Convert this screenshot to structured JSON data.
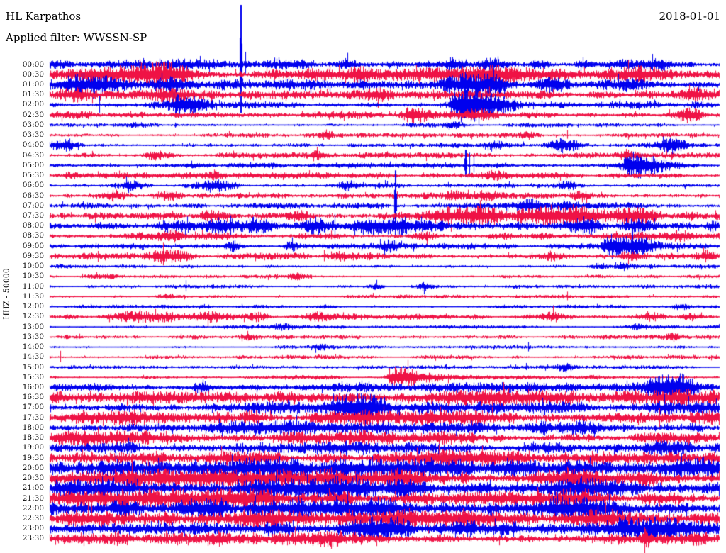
{
  "header": {
    "station": "HL Karpathos",
    "filter_line": "Applied filter: WWSSN-SP",
    "date": "2018-01-01"
  },
  "axis": {
    "left_label": "HHZ - 50000",
    "row_interval": "30 min",
    "time_format": "HH:MM"
  },
  "chart_data": {
    "type": "line",
    "subtype": "helicorder-seismogram",
    "title": "HL Karpathos",
    "filter": "WWSSN-SP",
    "date": "2018-01-01",
    "channel": "HHZ",
    "scale": 50000,
    "rows_per_day": 48,
    "minutes_per_row": 30,
    "legend_position": "none",
    "grid": false,
    "colors": {
      "blue": "#0000EE",
      "red": "#EF1245"
    },
    "rows": [
      {
        "t": "00:00",
        "c": "blue",
        "a": 5.5,
        "b": [
          [
            180,
            3,
            30
          ],
          [
            420,
            4,
            15
          ],
          [
            490,
            4,
            12
          ],
          [
            641,
            5,
            12
          ],
          [
            694,
            6,
            15
          ],
          [
            760,
            4,
            10
          ],
          [
            930,
            5,
            15
          ]
        ],
        "s": [
          [
            339,
            84,
            68
          ],
          [
            346,
            18,
            14
          ]
        ]
      },
      {
        "t": "00:30",
        "c": "red",
        "a": 6.5,
        "b": [
          [
            125,
            5,
            30
          ],
          [
            215,
            7,
            35
          ],
          [
            255,
            6,
            18
          ],
          [
            510,
            6,
            10
          ],
          [
            655,
            7,
            25
          ],
          [
            700,
            6,
            18
          ],
          [
            900,
            4,
            15
          ]
        ],
        "s": [
          [
            508,
            12,
            8
          ]
        ]
      },
      {
        "t": "01:00",
        "c": "blue",
        "a": 6,
        "b": [
          [
            125,
            7,
            28
          ],
          [
            240,
            7,
            22
          ],
          [
            657,
            8,
            18
          ],
          [
            692,
            9,
            14
          ],
          [
            780,
            5,
            10
          ],
          [
            885,
            5,
            14
          ]
        ],
        "s": [
          [
            240,
            12,
            8
          ]
        ]
      },
      {
        "t": "01:30",
        "c": "red",
        "a": 4.5,
        "b": [
          [
            110,
            5,
            22
          ],
          [
            240,
            5,
            18
          ],
          [
            530,
            4,
            12
          ],
          [
            980,
            4,
            14
          ]
        ],
        "s": [
          [
            85,
            9,
            7
          ]
        ]
      },
      {
        "t": "02:00",
        "c": "blue",
        "a": 4,
        "b": [
          [
            258,
            11,
            12,
            25
          ],
          [
            650,
            21,
            10,
            45
          ]
        ],
        "s": [
          [
            140,
            13,
            11
          ],
          [
            655,
            24,
            18
          ]
        ]
      },
      {
        "t": "02:30",
        "c": "red",
        "a": 4,
        "b": [
          [
            580,
            9,
            8,
            20
          ],
          [
            662,
            5,
            20
          ],
          [
            970,
            7,
            8,
            12
          ]
        ],
        "s": []
      },
      {
        "t": "03:00",
        "c": "blue",
        "a": 2.4,
        "b": [
          [
            190,
            2.5,
            15
          ],
          [
            640,
            2.5,
            10
          ]
        ],
        "s": []
      },
      {
        "t": "03:30",
        "c": "red",
        "a": 2.4,
        "b": [
          [
            460,
            4,
            6
          ],
          [
            745,
            3,
            8
          ]
        ],
        "s": [
          [
            800,
            7,
            5
          ]
        ]
      },
      {
        "t": "04:00",
        "c": "blue",
        "a": 3,
        "b": [
          [
            90,
            7,
            14
          ],
          [
            700,
            5,
            10
          ],
          [
            795,
            8,
            16
          ],
          [
            948,
            8,
            12
          ]
        ],
        "s": []
      },
      {
        "t": "04:30",
        "c": "red",
        "a": 3,
        "b": [
          [
            220,
            3.5,
            10
          ],
          [
            450,
            3.5,
            8
          ],
          [
            884,
            4,
            10
          ]
        ],
        "s": []
      },
      {
        "t": "05:00",
        "c": "blue",
        "a": 2.8,
        "b": [
          [
            890,
            13,
            8,
            40
          ]
        ],
        "s": [
          [
            656,
            22,
            16
          ],
          [
            662,
            18,
            12
          ],
          [
            668,
            14,
            10
          ],
          [
            893,
            18,
            12
          ]
        ]
      },
      {
        "t": "05:30",
        "c": "red",
        "a": 3.2,
        "b": [
          [
            100,
            3.5,
            10
          ],
          [
            300,
            3.5,
            10
          ],
          [
            700,
            4,
            12
          ]
        ],
        "s": []
      },
      {
        "t": "06:00",
        "c": "blue",
        "a": 3,
        "b": [
          [
            185,
            6,
            12
          ],
          [
            300,
            7,
            18
          ],
          [
            490,
            4,
            10
          ],
          [
            800,
            5,
            12
          ]
        ],
        "s": []
      },
      {
        "t": "06:30",
        "c": "red",
        "a": 3.4,
        "b": [
          [
            160,
            4,
            10
          ],
          [
            240,
            4,
            12
          ],
          [
            640,
            4,
            10
          ],
          [
            685,
            4,
            10
          ],
          [
            820,
            3.5,
            10
          ]
        ],
        "s": []
      },
      {
        "t": "07:00",
        "c": "blue",
        "a": 3.4,
        "b": [
          [
            745,
            5,
            14
          ],
          [
            800,
            4,
            10
          ]
        ],
        "s": [
          [
            557,
            50,
            22
          ],
          [
            795,
            9,
            20
          ]
        ]
      },
      {
        "t": "07:30",
        "c": "red",
        "a": 5.5,
        "b": [
          [
            300,
            5,
            15
          ],
          [
            420,
            5,
            12
          ],
          [
            630,
            7,
            15
          ],
          [
            680,
            7,
            18
          ],
          [
            765,
            8,
            25
          ],
          [
            825,
            8,
            28
          ],
          [
            900,
            6,
            18
          ]
        ],
        "s": []
      },
      {
        "t": "08:00",
        "c": "blue",
        "a": 6,
        "b": [
          [
            310,
            7,
            22
          ],
          [
            365,
            7,
            18
          ],
          [
            445,
            8,
            14
          ],
          [
            520,
            8,
            18
          ],
          [
            565,
            7,
            14
          ],
          [
            820,
            6,
            14
          ],
          [
            900,
            6,
            18
          ]
        ],
        "s": [
          [
            325,
            15,
            13
          ],
          [
            472,
            17,
            15
          ],
          [
            891,
            9,
            9
          ]
        ]
      },
      {
        "t": "08:30",
        "c": "red",
        "a": 4.2,
        "b": [
          [
            240,
            4,
            12
          ],
          [
            600,
            4,
            10
          ],
          [
            960,
            4,
            10
          ]
        ],
        "s": []
      },
      {
        "t": "09:00",
        "c": "blue",
        "a": 3,
        "b": [
          [
            330,
            5,
            8
          ],
          [
            410,
            5,
            7
          ],
          [
            550,
            5,
            8
          ],
          [
            860,
            12,
            6,
            25
          ],
          [
            900,
            8,
            10,
            20
          ]
        ],
        "s": [
          [
            891,
            21,
            17
          ]
        ]
      },
      {
        "t": "09:30",
        "c": "red",
        "a": 3.8,
        "b": [
          [
            225,
            6,
            18
          ],
          [
            255,
            5,
            14
          ],
          [
            480,
            5,
            10
          ],
          [
            780,
            5,
            12
          ],
          [
            890,
            5,
            10
          ],
          [
            1000,
            5,
            8
          ]
        ],
        "s": [
          [
            457,
            9,
            7
          ]
        ]
      },
      {
        "t": "10:00",
        "c": "blue",
        "a": 2,
        "b": [
          [
            845,
            3.5,
            8
          ],
          [
            880,
            3,
            8
          ]
        ],
        "s": []
      },
      {
        "t": "10:30",
        "c": "red",
        "a": 2,
        "b": [
          [
            150,
            2.5,
            14
          ],
          [
            420,
            2.5,
            10
          ]
        ],
        "s": []
      },
      {
        "t": "11:00",
        "c": "blue",
        "a": 2,
        "b": [
          [
            530,
            3.5,
            8
          ],
          [
            600,
            3.5,
            7
          ]
        ],
        "s": [
          [
            262,
            9,
            7
          ]
        ]
      },
      {
        "t": "11:30",
        "c": "red",
        "a": 2,
        "b": [
          [
            240,
            2.5,
            10
          ]
        ],
        "s": [
          [
            800,
            7,
            5
          ]
        ]
      },
      {
        "t": "12:00",
        "c": "blue",
        "a": 2,
        "b": [
          [
            460,
            2.5,
            10
          ],
          [
            960,
            2.5,
            8
          ]
        ],
        "s": []
      },
      {
        "t": "12:30",
        "c": "red",
        "a": 3.2,
        "b": [
          [
            180,
            5,
            22
          ],
          [
            235,
            5,
            18
          ],
          [
            295,
            4,
            14
          ],
          [
            365,
            5,
            10
          ],
          [
            445,
            4,
            10
          ],
          [
            780,
            5,
            14
          ],
          [
            920,
            4,
            10
          ],
          [
            975,
            4,
            9
          ]
        ],
        "s": []
      },
      {
        "t": "13:00",
        "c": "blue",
        "a": 1.9,
        "b": [
          [
            400,
            2.5,
            9
          ],
          [
            900,
            2.5,
            8
          ]
        ],
        "s": []
      },
      {
        "t": "13:30",
        "c": "red",
        "a": 2.3,
        "b": [
          [
            350,
            4,
            10
          ],
          [
            950,
            3,
            8
          ]
        ],
        "s": []
      },
      {
        "t": "14:00",
        "c": "blue",
        "a": 1.9,
        "b": [
          [
            450,
            2.5,
            10
          ]
        ],
        "s": [
          [
            745,
            7,
            6
          ]
        ]
      },
      {
        "t": "14:30",
        "c": "red",
        "a": 2.3,
        "b": [],
        "s": [
          [
            85,
            9,
            7
          ]
        ]
      },
      {
        "t": "15:00",
        "c": "blue",
        "a": 1.9,
        "b": [
          [
            797,
            5,
            8
          ]
        ],
        "s": [
          [
            742,
            6,
            4
          ]
        ]
      },
      {
        "t": "15:30",
        "c": "red",
        "a": 2.3,
        "b": [
          [
            555,
            11,
            5,
            45
          ]
        ],
        "s": [
          [
            549,
            13,
            8
          ]
        ]
      },
      {
        "t": "16:00",
        "c": "blue",
        "a": 3.6,
        "b": [
          [
            285,
            7,
            8
          ],
          [
            600,
            2,
            150
          ],
          [
            860,
            2,
            100
          ],
          [
            930,
            12,
            15,
            25
          ],
          [
            960,
            10,
            12
          ]
        ],
        "s": [
          [
            286,
            11,
            18
          ],
          [
            940,
            15,
            11
          ]
        ]
      },
      {
        "t": "16:30",
        "c": "red",
        "a": 6.5,
        "b": [
          [
            150,
            3,
            60
          ],
          [
            400,
            3,
            80
          ],
          [
            700,
            3,
            80
          ],
          [
            950,
            3,
            50
          ]
        ],
        "s": []
      },
      {
        "t": "17:00",
        "c": "blue",
        "a": 6.5,
        "b": [
          [
            490,
            9,
            18
          ],
          [
            525,
            8,
            14
          ],
          [
            960,
            4,
            40
          ]
        ],
        "s": []
      },
      {
        "t": "17:30",
        "c": "red",
        "a": 7,
        "b": [
          [
            250,
            3,
            80
          ],
          [
            600,
            3,
            80
          ],
          [
            900,
            3,
            60
          ]
        ],
        "s": []
      },
      {
        "t": "18:00",
        "c": "blue",
        "a": 6.5,
        "b": [
          [
            350,
            3,
            80
          ],
          [
            800,
            3,
            60
          ]
        ],
        "s": []
      },
      {
        "t": "18:30",
        "c": "red",
        "a": 6,
        "b": [
          [
            150,
            3,
            60
          ],
          [
            550,
            3,
            80
          ]
        ],
        "s": []
      },
      {
        "t": "19:00",
        "c": "blue",
        "a": 6,
        "b": [
          [
            400,
            3,
            80
          ],
          [
            900,
            3,
            60
          ]
        ],
        "s": []
      },
      {
        "t": "19:30",
        "c": "red",
        "a": 7,
        "b": [
          [
            200,
            3,
            80
          ],
          [
            700,
            3,
            80
          ]
        ],
        "s": []
      },
      {
        "t": "20:00",
        "c": "blue",
        "a": 9.5,
        "b": [
          [
            150,
            2.5,
            60
          ],
          [
            420,
            3,
            80
          ],
          [
            700,
            2.5,
            70
          ],
          [
            950,
            2.5,
            50
          ]
        ],
        "s": []
      },
      {
        "t": "20:30",
        "c": "red",
        "a": 9.5,
        "b": [
          [
            250,
            3,
            70
          ],
          [
            550,
            2.5,
            60
          ],
          [
            850,
            3,
            70
          ]
        ],
        "s": []
      },
      {
        "t": "21:00",
        "c": "blue",
        "a": 10,
        "b": [
          [
            200,
            2.5,
            80
          ],
          [
            500,
            3,
            70
          ],
          [
            800,
            2.5,
            60
          ]
        ],
        "s": []
      },
      {
        "t": "21:30",
        "c": "red",
        "a": 9.5,
        "b": [
          [
            350,
            3,
            80
          ],
          [
            700,
            2.5,
            70
          ]
        ],
        "s": []
      },
      {
        "t": "22:00",
        "c": "blue",
        "a": 10.5,
        "b": [
          [
            150,
            2.5,
            60
          ],
          [
            450,
            3,
            90
          ],
          [
            750,
            2.5,
            70
          ]
        ],
        "s": []
      },
      {
        "t": "22:30",
        "c": "red",
        "a": 8.5,
        "b": [
          [
            300,
            2.5,
            70
          ],
          [
            600,
            3,
            80
          ],
          [
            900,
            2.5,
            50
          ]
        ],
        "s": []
      },
      {
        "t": "23:00",
        "c": "blue",
        "a": 10,
        "b": [
          [
            250,
            3,
            80
          ],
          [
            550,
            2.5,
            60
          ],
          [
            880,
            3,
            60
          ]
        ],
        "s": []
      },
      {
        "t": "23:30",
        "c": "red",
        "a": 7.5,
        "b": [
          [
            400,
            2.5,
            90
          ],
          [
            909,
            9,
            3,
            5
          ]
        ],
        "s": [
          [
            909,
            4,
            22
          ]
        ]
      }
    ]
  }
}
